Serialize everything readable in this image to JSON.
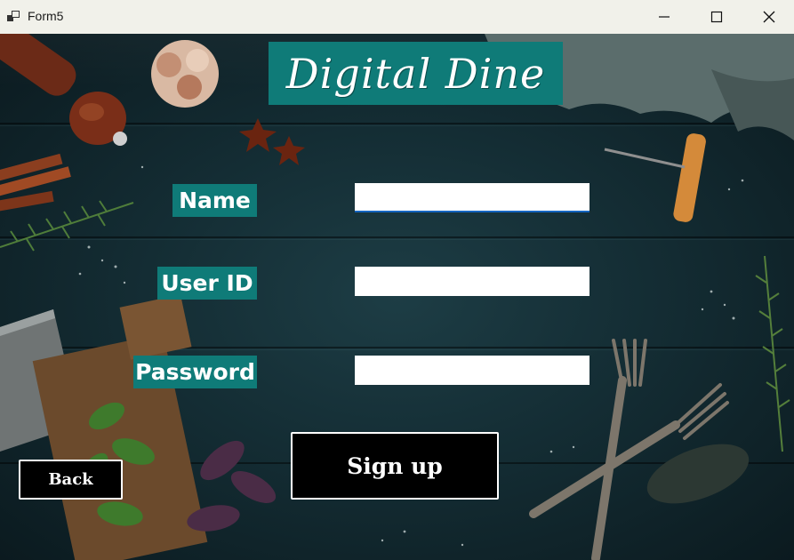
{
  "window": {
    "title": "Form5",
    "icon": "app-form-icon",
    "controls": {
      "minimize": "minimize-icon",
      "maximize": "maximize-icon",
      "close": "close-icon"
    }
  },
  "banner": {
    "title": "Digital Dine"
  },
  "form": {
    "name_label": "Name",
    "name_value": "",
    "userid_label": "User ID",
    "userid_value": "",
    "password_label": "Password",
    "password_value": ""
  },
  "buttons": {
    "signup_label": "Sign up",
    "back_label": "Back"
  },
  "colors": {
    "accent_teal": "#0f7b78",
    "button_bg": "#000000",
    "focus_underline": "#1565c0"
  }
}
